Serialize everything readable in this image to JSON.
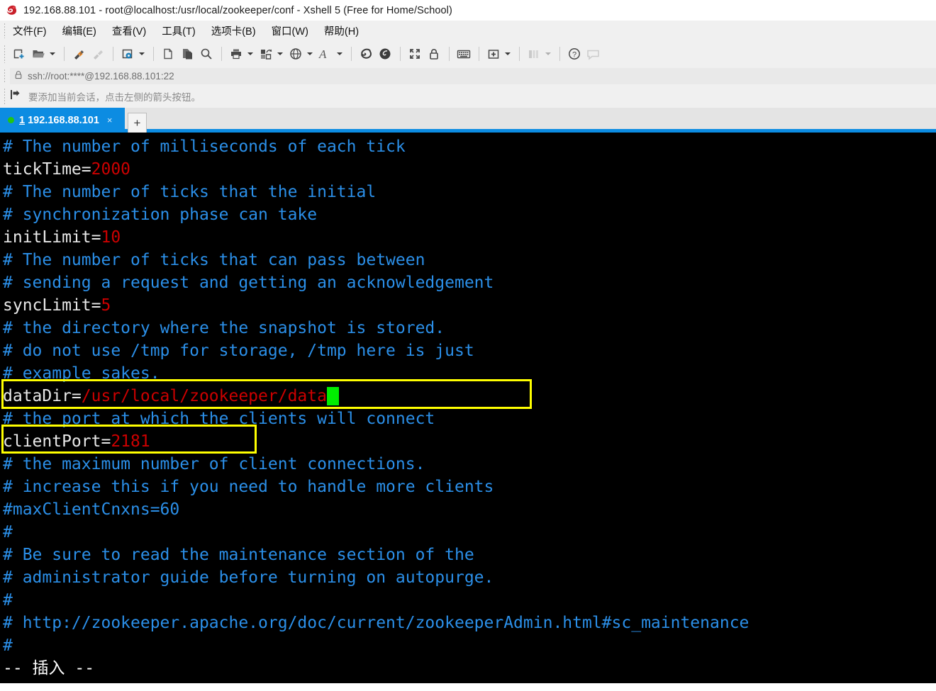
{
  "window": {
    "title": "192.168.88.101 - root@localhost:/usr/local/zookeeper/conf - Xshell 5 (Free for Home/School)",
    "app_icon": "xshell-logo-icon"
  },
  "menubar": {
    "items": [
      {
        "label": "文件(F)",
        "accel": "F"
      },
      {
        "label": "编辑(E)",
        "accel": "E"
      },
      {
        "label": "查看(V)",
        "accel": "V"
      },
      {
        "label": "工具(T)",
        "accel": "T"
      },
      {
        "label": "选项卡(B)",
        "accel": "B"
      },
      {
        "label": "窗口(W)",
        "accel": "W"
      },
      {
        "label": "帮助(H)",
        "accel": "H"
      }
    ]
  },
  "toolbar": {
    "buttons": [
      {
        "name": "new-session-icon",
        "enabled": true
      },
      {
        "name": "open-folder-icon",
        "enabled": true,
        "dropdown": true
      },
      {
        "name": "connect-icon",
        "enabled": true
      },
      {
        "name": "disconnect-icon",
        "enabled": false
      },
      {
        "name": "session-properties-icon",
        "enabled": true,
        "dropdown": true
      },
      {
        "name": "cut-copy-icon",
        "enabled": true
      },
      {
        "name": "paste-icon",
        "enabled": true
      },
      {
        "name": "find-icon",
        "enabled": true
      },
      {
        "name": "print-icon",
        "enabled": true,
        "dropdown": true
      },
      {
        "name": "file-transfer-icon",
        "enabled": true,
        "dropdown": true
      },
      {
        "name": "globe-icon",
        "enabled": true,
        "dropdown": true
      },
      {
        "name": "font-icon",
        "enabled": true,
        "dropdown": true
      },
      {
        "name": "xshell-icon",
        "enabled": true
      },
      {
        "name": "xftp-icon",
        "enabled": true
      },
      {
        "name": "fullscreen-icon",
        "enabled": true
      },
      {
        "name": "lock-icon",
        "enabled": true
      },
      {
        "name": "keyboard-icon",
        "enabled": true
      },
      {
        "name": "add-to-folder-icon",
        "enabled": true,
        "dropdown": true
      },
      {
        "name": "layout-icon",
        "enabled": false,
        "dropdown": true
      },
      {
        "name": "help-icon",
        "enabled": true
      },
      {
        "name": "chat-icon",
        "enabled": false
      }
    ]
  },
  "address_bar": {
    "icon": "lock-icon",
    "value": "ssh://root:****@192.168.88.101:22"
  },
  "hint_bar": {
    "icon": "add-session-arrow-icon",
    "text": "要添加当前会话，点击左侧的箭头按钮。"
  },
  "tabs": {
    "active": {
      "index": "1",
      "label": "192.168.88.101",
      "status": "connected",
      "close": "×"
    },
    "new_tab_label": "+"
  },
  "terminal": {
    "prompt_mode": "-- 插入 --",
    "cursor": {
      "line_index": 11,
      "color": "#00ee00"
    },
    "colors": {
      "background": "#000000",
      "comment": "#2b8fe8",
      "key": "#e8e8e8",
      "value": "#cc0000",
      "highlight_box": "#ffff00"
    },
    "lines": [
      {
        "type": "comment",
        "text": "# The number of milliseconds of each tick"
      },
      {
        "type": "kv",
        "key": "tickTime=",
        "value": "2000"
      },
      {
        "type": "comment",
        "text": "# The number of ticks that the initial"
      },
      {
        "type": "comment",
        "text": "# synchronization phase can take"
      },
      {
        "type": "kv",
        "key": "initLimit=",
        "value": "10"
      },
      {
        "type": "comment",
        "text": "# The number of ticks that can pass between"
      },
      {
        "type": "comment",
        "text": "# sending a request and getting an acknowledgement"
      },
      {
        "type": "kv",
        "key": "syncLimit=",
        "value": "5"
      },
      {
        "type": "comment",
        "text": "# the directory where the snapshot is stored."
      },
      {
        "type": "comment",
        "text": "# do not use /tmp for storage, /tmp here is just"
      },
      {
        "type": "comment",
        "text": "# example sakes."
      },
      {
        "type": "kv",
        "key": "dataDir=",
        "value": "/usr/local/zookeeper/data",
        "cursor": true
      },
      {
        "type": "comment",
        "text": "# the port at which the clients will connect"
      },
      {
        "type": "kv",
        "key": "clientPort=",
        "value": "2181"
      },
      {
        "type": "comment",
        "text": "# the maximum number of client connections."
      },
      {
        "type": "comment",
        "text": "# increase this if you need to handle more clients"
      },
      {
        "type": "comment",
        "text": "#maxClientCnxns=60"
      },
      {
        "type": "comment",
        "text": "#"
      },
      {
        "type": "comment",
        "text": "# Be sure to read the maintenance section of the"
      },
      {
        "type": "comment",
        "text": "# administrator guide before turning on autopurge."
      },
      {
        "type": "comment",
        "text": "#"
      },
      {
        "type": "comment",
        "text": "# http://zookeeper.apache.org/doc/current/zookeeperAdmin.html#sc_maintenance"
      },
      {
        "type": "comment",
        "text": "#"
      },
      {
        "type": "status",
        "text": "-- 插入 --"
      }
    ],
    "highlights": [
      {
        "name": "datadir-highlight-box",
        "target": "dataDir"
      },
      {
        "name": "clientport-highlight-box",
        "target": "clientPort"
      }
    ]
  }
}
